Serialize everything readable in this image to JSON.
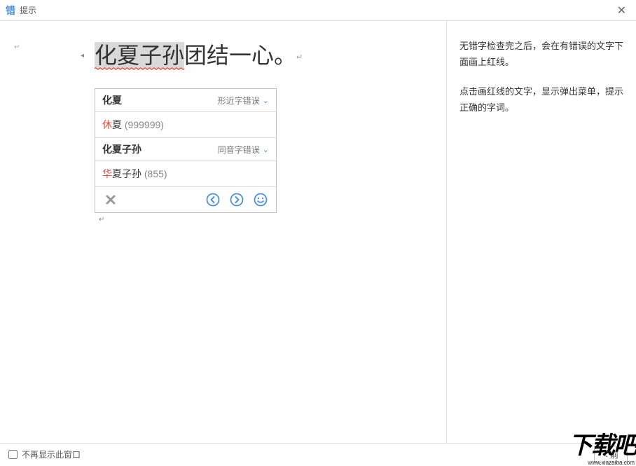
{
  "titlebar": {
    "app_icon": "错",
    "title": "提示"
  },
  "sentence": {
    "highlighted": "化夏子孙",
    "rest": "团结一心。"
  },
  "suggestions": {
    "group1": {
      "word": "化夏",
      "type": "形近字错误",
      "item": {
        "corr": "休",
        "rest": "夏",
        "freq": "(999999)"
      }
    },
    "group2": {
      "word": "化夏子孙",
      "type": "同音字错误",
      "item": {
        "corr": "华",
        "rest": "夏子孙",
        "freq": "(855)"
      }
    }
  },
  "help": {
    "p1": "无错字检查完之后，会在有错误的文字下面画上红线。",
    "p2": "点击画红线的文字，显示弹出菜单，提示正确的字词。"
  },
  "footer": {
    "checkbox_label": "不再显示此窗口",
    "prev_button": "< 前"
  },
  "watermark": {
    "big": "下载吧",
    "small": "www.xiazaiba.com"
  }
}
